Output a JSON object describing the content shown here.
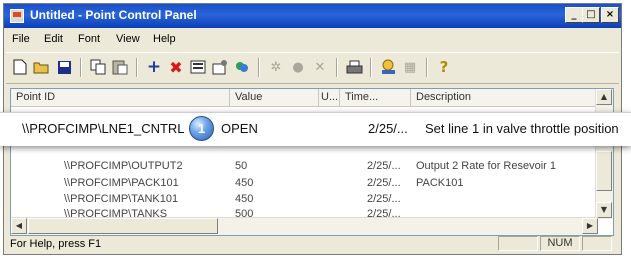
{
  "window": {
    "title": "Untitled - Point Control Panel",
    "controls": {
      "minimize": "_",
      "maximize": "□",
      "close": "×"
    }
  },
  "menu": [
    "File",
    "Edit",
    "Font",
    "View",
    "Help"
  ],
  "toolbar": {
    "icons": [
      "new-icon",
      "open-icon",
      "save-icon",
      "copy-icon",
      "paste-icon",
      "add-icon",
      "delete-icon",
      "properties-icon",
      "settings-icon",
      "filter-icon",
      "disabled-icon-1",
      "disabled-icon-2",
      "disabled-icon-3",
      "print-icon",
      "quality-icon",
      "disabled-icon-4",
      "help-icon"
    ]
  },
  "list": {
    "columns": [
      "Point ID",
      "Value",
      "U...",
      "Time...",
      "Description"
    ],
    "rows": [
      {
        "point_id": "\\\\PROFCIMP\\OUTPUT2",
        "value": "50",
        "units": "",
        "time": "2/25/...",
        "description": "Output 2 Rate for Resevoir 1"
      },
      {
        "point_id": "\\\\PROFCIMP\\PACK101",
        "value": "450",
        "units": "",
        "time": "2/25/...",
        "description": "PACK101"
      },
      {
        "point_id": "\\\\PROFCIMP\\TANK101",
        "value": "450",
        "units": "",
        "time": "2/25/...",
        "description": ""
      },
      {
        "point_id": "\\\\PROFCIMP\\TANKS",
        "value": "500",
        "units": "",
        "time": "2/25/...",
        "description": ""
      }
    ]
  },
  "callout": {
    "point_id": "\\\\PROFCIMP\\LNE1_CNTRL",
    "badge": "1",
    "value": "OPEN",
    "time": "2/25/...",
    "description": "Set line 1 in valve  throttle position"
  },
  "status": {
    "help_text": "For Help, press F1",
    "num": "NUM"
  }
}
